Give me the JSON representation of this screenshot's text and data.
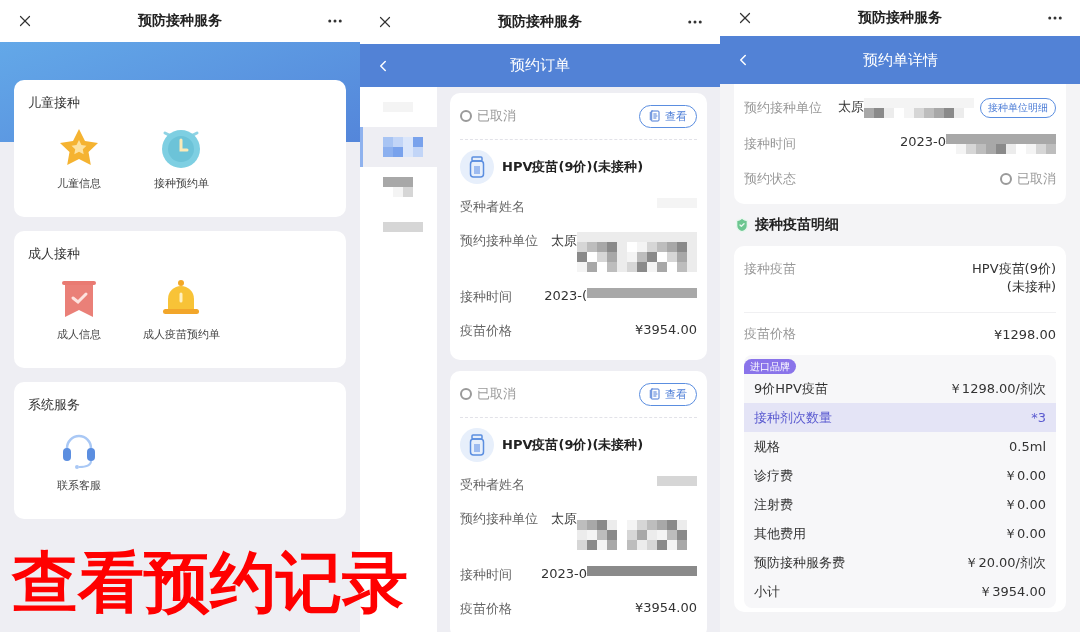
{
  "home": {
    "header_title": "预防接种服务",
    "sections": [
      {
        "title": "儿童接种",
        "items": [
          {
            "label": "儿童信息",
            "kind": "star"
          },
          {
            "label": "接种预约单",
            "kind": "clock"
          }
        ]
      },
      {
        "title": "成人接种",
        "items": [
          {
            "label": "成人信息",
            "kind": "ribbon"
          },
          {
            "label": "成人疫苗预约单",
            "kind": "bell"
          }
        ]
      },
      {
        "title": "系统服务",
        "items": [
          {
            "label": "联系客服",
            "kind": "headset"
          }
        ]
      }
    ]
  },
  "orders": {
    "header_title": "预防接种服务",
    "page_title": "预约订单",
    "sidebar": [
      {
        "selected": false
      },
      {
        "selected": true
      },
      {
        "selected": false
      },
      {
        "selected": false
      }
    ],
    "cards": [
      {
        "status": "已取消",
        "view_button": "查看",
        "vaccine": "HPV疫苗(9价)(未接种)",
        "fields": [
          {
            "label": "受种者姓名",
            "redacted": true
          },
          {
            "label": "预约接种单位",
            "value": "太原",
            "redacted": true
          },
          {
            "label": "接种时间",
            "value": "2023-(",
            "redacted": true
          },
          {
            "label": "疫苗价格",
            "value": "¥3954.00"
          }
        ]
      },
      {
        "status": "已取消",
        "view_button": "查看",
        "vaccine": "HPV疫苗(9价)(未接种)",
        "fields": [
          {
            "label": "受种者姓名",
            "redacted": true
          },
          {
            "label": "预约接种单位",
            "value": "太原",
            "redacted": true
          },
          {
            "label": "接种时间",
            "value": "2023-0",
            "redacted": true
          },
          {
            "label": "疫苗价格",
            "value": "¥3954.00"
          }
        ]
      }
    ]
  },
  "detail": {
    "header_title": "预防接种服务",
    "page_title": "预约单详情",
    "unit": {
      "label": "预约接种单位",
      "value": "太原",
      "button": "接种单位明细"
    },
    "time": {
      "label": "接种时间",
      "value": "2023-0"
    },
    "status": {
      "label": "预约状态",
      "value": "已取消"
    },
    "section_title": "接种疫苗明细",
    "vaccine": {
      "label": "接种疫苗",
      "value_lines": [
        "HPV疫苗(9价)",
        "(未接种)"
      ]
    },
    "price": {
      "label": "疫苗价格",
      "value": "¥1298.00"
    },
    "badge": "进口品牌",
    "items": [
      {
        "label": "9价HPV疫苗",
        "value": "￥1298.00/剂次",
        "highlighted": false
      },
      {
        "label": "接种剂次数量",
        "value": "*3",
        "highlighted": true
      },
      {
        "label": "规格",
        "value": "0.5ml",
        "highlighted": false
      },
      {
        "label": "诊疗费",
        "value": "￥0.00",
        "highlighted": false
      },
      {
        "label": "注射费",
        "value": "￥0.00",
        "highlighted": false
      },
      {
        "label": "其他费用",
        "value": "￥0.00",
        "highlighted": false
      },
      {
        "label": "预防接种服务费",
        "value": "￥20.00/剂次",
        "highlighted": false
      },
      {
        "label": "小计",
        "value": "￥3954.00",
        "highlighted": false
      }
    ]
  },
  "caption": "查看预约记录"
}
